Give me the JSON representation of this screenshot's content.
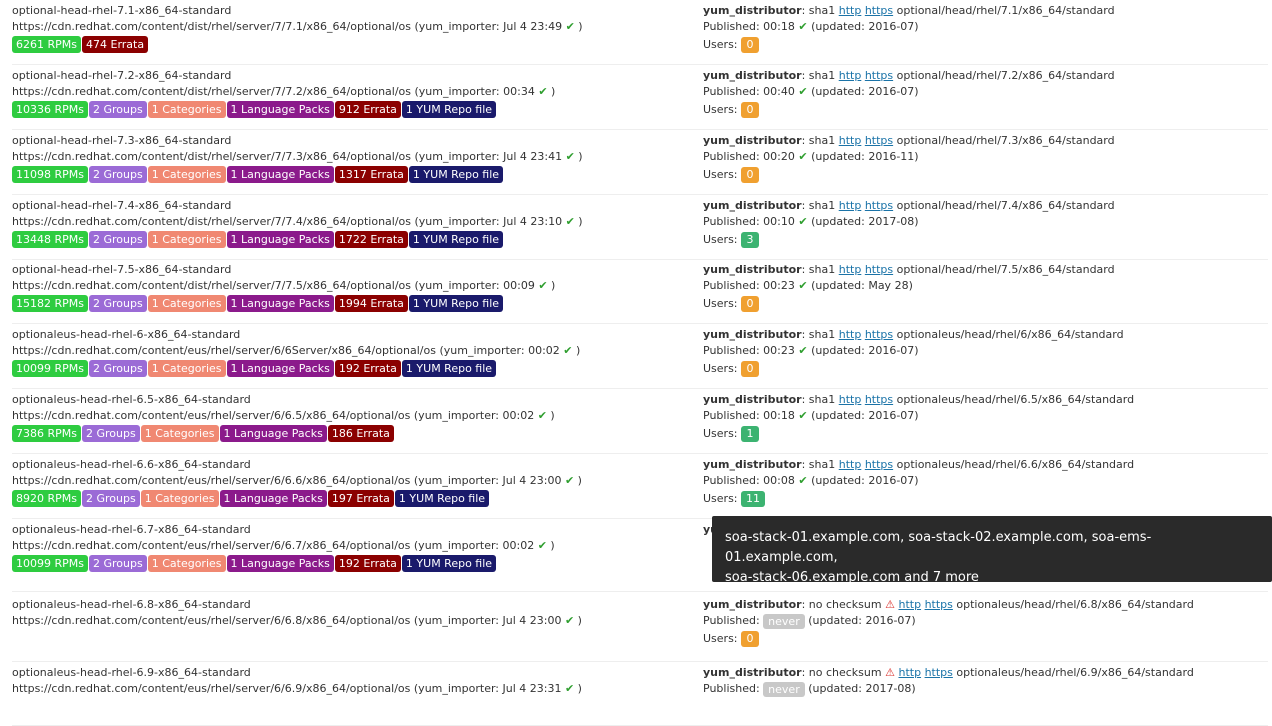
{
  "labels": {
    "distributor": "yum_distributor",
    "sha1": ": sha1",
    "no_checksum": ": no checksum",
    "http": "http",
    "https": "https",
    "published": "Published:",
    "users": "Users:",
    "never": "never"
  },
  "repos": [
    {
      "name": "optional-head-rhel-7.1-x86_64-standard",
      "url": "https://cdn.redhat.com/content/dist/rhel/server/7/7.1/x86_64/optional/os (yum_importer: Jul 4 23:49",
      "badges": [
        {
          "label": "6261 RPMs",
          "type": "rpm"
        },
        {
          "label": "474 Errata",
          "type": "err"
        }
      ],
      "path": "optional/head/rhel/7.1/x86_64/standard",
      "published": "00:18",
      "updated": "(updated: 2016-07)",
      "users": "0"
    },
    {
      "name": "optional-head-rhel-7.2-x86_64-standard",
      "url": "https://cdn.redhat.com/content/dist/rhel/server/7/7.2/x86_64/optional/os (yum_importer: 00:34",
      "badges": [
        {
          "label": "10336 RPMs",
          "type": "rpm"
        },
        {
          "label": "2 Groups",
          "type": "grp"
        },
        {
          "label": "1 Categories",
          "type": "cat"
        },
        {
          "label": "1 Language Packs",
          "type": "lang"
        },
        {
          "label": "912 Errata",
          "type": "err"
        },
        {
          "label": "1 YUM Repo file",
          "type": "yum"
        }
      ],
      "path": "optional/head/rhel/7.2/x86_64/standard",
      "published": "00:40",
      "updated": "(updated: 2016-07)",
      "users": "0"
    },
    {
      "name": "optional-head-rhel-7.3-x86_64-standard",
      "url": "https://cdn.redhat.com/content/dist/rhel/server/7/7.3/x86_64/optional/os (yum_importer: Jul 4 23:41",
      "badges": [
        {
          "label": "11098 RPMs",
          "type": "rpm"
        },
        {
          "label": "2 Groups",
          "type": "grp"
        },
        {
          "label": "1 Categories",
          "type": "cat"
        },
        {
          "label": "1 Language Packs",
          "type": "lang"
        },
        {
          "label": "1317 Errata",
          "type": "err"
        },
        {
          "label": "1 YUM Repo file",
          "type": "yum"
        }
      ],
      "path": "optional/head/rhel/7.3/x86_64/standard",
      "published": "00:20",
      "updated": "(updated: 2016-11)",
      "users": "0"
    },
    {
      "name": "optional-head-rhel-7.4-x86_64-standard",
      "url": "https://cdn.redhat.com/content/dist/rhel/server/7/7.4/x86_64/optional/os (yum_importer: Jul 4 23:10",
      "badges": [
        {
          "label": "13448 RPMs",
          "type": "rpm"
        },
        {
          "label": "2 Groups",
          "type": "grp"
        },
        {
          "label": "1 Categories",
          "type": "cat"
        },
        {
          "label": "1 Language Packs",
          "type": "lang"
        },
        {
          "label": "1722 Errata",
          "type": "err"
        },
        {
          "label": "1 YUM Repo file",
          "type": "yum"
        }
      ],
      "path": "optional/head/rhel/7.4/x86_64/standard",
      "published": "00:10",
      "updated": "(updated: 2017-08)",
      "users": "3"
    },
    {
      "name": "optional-head-rhel-7.5-x86_64-standard",
      "url": "https://cdn.redhat.com/content/dist/rhel/server/7/7.5/x86_64/optional/os (yum_importer: 00:09",
      "badges": [
        {
          "label": "15182 RPMs",
          "type": "rpm"
        },
        {
          "label": "2 Groups",
          "type": "grp"
        },
        {
          "label": "1 Categories",
          "type": "cat"
        },
        {
          "label": "1 Language Packs",
          "type": "lang"
        },
        {
          "label": "1994 Errata",
          "type": "err"
        },
        {
          "label": "1 YUM Repo file",
          "type": "yum"
        }
      ],
      "path": "optional/head/rhel/7.5/x86_64/standard",
      "published": "00:23",
      "updated": "(updated: May 28)",
      "users": "0"
    },
    {
      "name": "optionaleus-head-rhel-6-x86_64-standard",
      "url": "https://cdn.redhat.com/content/eus/rhel/server/6/6Server/x86_64/optional/os (yum_importer: 00:02",
      "badges": [
        {
          "label": "10099 RPMs",
          "type": "rpm"
        },
        {
          "label": "2 Groups",
          "type": "grp"
        },
        {
          "label": "1 Categories",
          "type": "cat"
        },
        {
          "label": "1 Language Packs",
          "type": "lang"
        },
        {
          "label": "192 Errata",
          "type": "err"
        },
        {
          "label": "1 YUM Repo file",
          "type": "yum"
        }
      ],
      "path": "optionaleus/head/rhel/6/x86_64/standard",
      "published": "00:23",
      "updated": "(updated: 2016-07)",
      "users": "0"
    },
    {
      "name": "optionaleus-head-rhel-6.5-x86_64-standard",
      "url": "https://cdn.redhat.com/content/eus/rhel/server/6/6.5/x86_64/optional/os (yum_importer: 00:02",
      "badges": [
        {
          "label": "7386 RPMs",
          "type": "rpm"
        },
        {
          "label": "2 Groups",
          "type": "grp"
        },
        {
          "label": "1 Categories",
          "type": "cat"
        },
        {
          "label": "1 Language Packs",
          "type": "lang"
        },
        {
          "label": "186 Errata",
          "type": "err"
        }
      ],
      "path": "optionaleus/head/rhel/6.5/x86_64/standard",
      "published": "00:18",
      "updated": "(updated: 2016-07)",
      "users": "1"
    },
    {
      "name": "optionaleus-head-rhel-6.6-x86_64-standard",
      "url": "https://cdn.redhat.com/content/eus/rhel/server/6/6.6/x86_64/optional/os (yum_importer: Jul 4 23:00",
      "badges": [
        {
          "label": "8920 RPMs",
          "type": "rpm"
        },
        {
          "label": "2 Groups",
          "type": "grp"
        },
        {
          "label": "1 Categories",
          "type": "cat"
        },
        {
          "label": "1 Language Packs",
          "type": "lang"
        },
        {
          "label": "197 Errata",
          "type": "err"
        },
        {
          "label": "1 YUM Repo file",
          "type": "yum"
        }
      ],
      "path": "optionaleus/head/rhel/6.6/x86_64/standard",
      "published": "00:08",
      "updated": "(updated: 2016-07)",
      "users": "11"
    },
    {
      "name": "optionaleus-head-rhel-6.7-x86_64-standard",
      "url": "https://cdn.redhat.com/content/eus/rhel/server/6/6.7/x86_64/optional/os (yum_importer: 00:02",
      "badges": [
        {
          "label": "10099 RPMs",
          "type": "rpm"
        },
        {
          "label": "2 Groups",
          "type": "grp"
        },
        {
          "label": "1 Categories",
          "type": "cat"
        },
        {
          "label": "1 Language Packs",
          "type": "lang"
        },
        {
          "label": "192 Errata",
          "type": "err"
        },
        {
          "label": "1 YUM Repo file",
          "type": "yum"
        }
      ],
      "path": "optionaleus/head/rhel/6.7/x86_64/standard",
      "published": "",
      "updated": "",
      "users": ""
    },
    {
      "name": "optionaleus-head-rhel-6.8-x86_64-standard",
      "url": "https://cdn.redhat.com/content/eus/rhel/server/6/6.8/x86_64/optional/os (yum_importer: Jul 4 23:00",
      "badges": [],
      "checksum": "none",
      "path": "optionaleus/head/rhel/6.8/x86_64/standard",
      "published": "never",
      "updated": "(updated: 2016-07)",
      "users": "0"
    },
    {
      "name": "optionaleus-head-rhel-6.9-x86_64-standard",
      "url": "https://cdn.redhat.com/content/eus/rhel/server/6/6.9/x86_64/optional/os (yum_importer: Jul 4 23:31",
      "badges": [],
      "checksum": "none",
      "path": "optionaleus/head/rhel/6.9/x86_64/standard",
      "published": "never",
      "updated": "(updated: 2017-08)",
      "users": ""
    }
  ],
  "tooltip": {
    "line1": "soa-stack-01.example.com, soa-stack-02.example.com, soa-ems-01.example.com,",
    "line2": "soa-stack-06.example.com and 7 more"
  },
  "colors": {
    "rpm": "#2ecc40",
    "grp": "#9b6bd6",
    "cat": "#f08872",
    "lang": "#8b1a8b",
    "err": "#8b0000",
    "yum": "#1a1a6b",
    "users_zero": "#f0a030",
    "users_pos": "#3cb371"
  },
  "icons": {
    "check": "check-icon",
    "warning": "warning-icon"
  }
}
